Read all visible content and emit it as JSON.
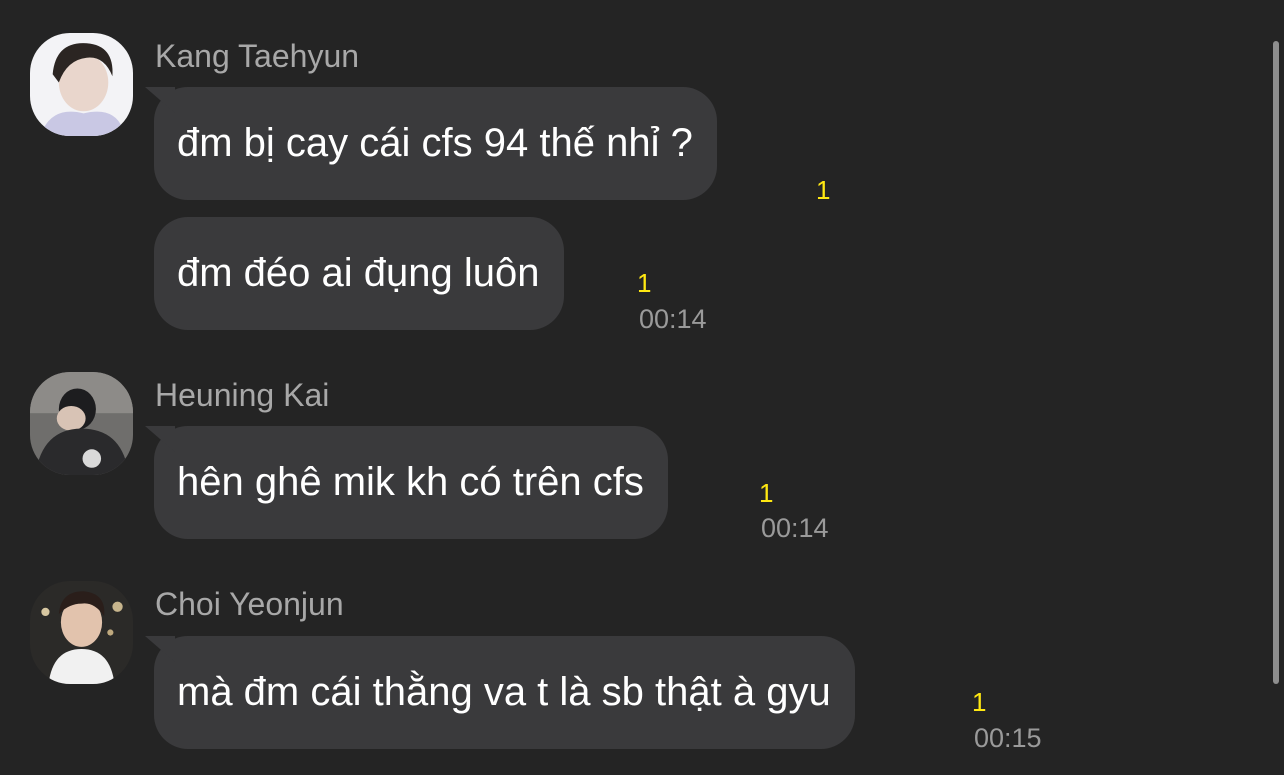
{
  "messages": [
    {
      "sender": "Kang Taehyun",
      "avatar_icon": "profile-photo-icon",
      "bubbles": [
        {
          "text": "đm bị cay cái cfs 94 thế nhỉ ?",
          "unread": "1",
          "time": ""
        },
        {
          "text": "đm đéo ai đụng luôn",
          "unread": "1",
          "time": "00:14"
        }
      ]
    },
    {
      "sender": "Heuning Kai",
      "avatar_icon": "profile-photo-icon",
      "bubbles": [
        {
          "text": "hên ghê mik kh có trên cfs",
          "unread": "1",
          "time": "00:14"
        }
      ]
    },
    {
      "sender": "Choi Yeonjun",
      "avatar_icon": "profile-photo-icon",
      "bubbles": [
        {
          "text": "mà đm cái thằng va t là sb thật à gyu",
          "unread": "1",
          "time": "00:15"
        }
      ]
    }
  ],
  "colors": {
    "background": "#242424",
    "bubble": "#3a3a3c",
    "unread": "#ffe812",
    "sender": "#a8a8a8",
    "time": "#9a9a9a"
  }
}
